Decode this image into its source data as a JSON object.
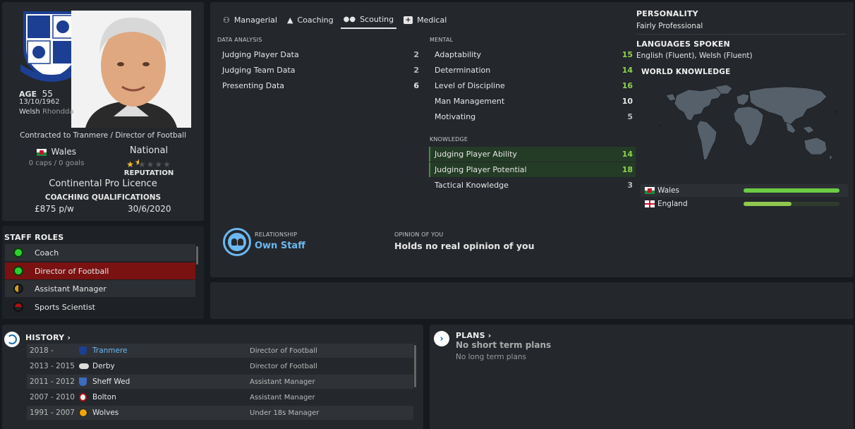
{
  "profile": {
    "age_label": "AGE",
    "age": "55",
    "dob": "13/10/1962",
    "nationality": "Welsh",
    "birthplace": "Rhondda",
    "contract": "Contracted to Tranmere / Director of Football",
    "nation": "Wales",
    "caps": "0 caps / 0 goals",
    "reputation_level": "National",
    "reputation_label": "REPUTATION",
    "reputation_stars": 1.5,
    "licence": "Continental Pro Licence",
    "qualifications_label": "COACHING QUALIFICATIONS",
    "wage": "£875 p/w",
    "contract_end": "30/6/2020"
  },
  "staff_roles": {
    "title": "STAFF ROLES",
    "items": [
      {
        "label": "Coach",
        "suitability": "green"
      },
      {
        "label": "Director of Football",
        "suitability": "green"
      },
      {
        "label": "Assistant Manager",
        "suitability": "half"
      },
      {
        "label": "Sports Scientist",
        "suitability": "red"
      }
    ]
  },
  "tabs": [
    {
      "label": "Managerial",
      "icon": "managerial-icon"
    },
    {
      "label": "Coaching",
      "icon": "coaching-icon"
    },
    {
      "label": "Scouting",
      "icon": "binoculars-icon"
    },
    {
      "label": "Medical",
      "icon": "medical-icon"
    }
  ],
  "data_analysis": {
    "title": "DATA ANALYSIS",
    "rows": [
      {
        "label": "Judging Player Data",
        "value": "2"
      },
      {
        "label": "Judging Team Data",
        "value": "2"
      },
      {
        "label": "Presenting Data",
        "value": "6"
      }
    ]
  },
  "mental": {
    "title": "MENTAL",
    "rows": [
      {
        "label": "Adaptability",
        "value": "15"
      },
      {
        "label": "Determination",
        "value": "14"
      },
      {
        "label": "Level of Discipline",
        "value": "16"
      },
      {
        "label": "Man Management",
        "value": "10"
      },
      {
        "label": "Motivating",
        "value": "5"
      }
    ]
  },
  "knowledge": {
    "title": "KNOWLEDGE",
    "rows": [
      {
        "label": "Judging Player Ability",
        "value": "14"
      },
      {
        "label": "Judging Player Potential",
        "value": "18"
      },
      {
        "label": "Tactical Knowledge",
        "value": "3"
      }
    ]
  },
  "relationship": {
    "label": "RELATIONSHIP",
    "value": "Own Staff",
    "opinion_label": "OPINION OF YOU",
    "opinion_value": "Holds no real opinion of you"
  },
  "personality": {
    "title": "PERSONALITY",
    "value": "Fairly Professional",
    "languages_title": "LANGUAGES SPOKEN",
    "languages": "English (Fluent), Welsh (Fluent)",
    "world_title": "WORLD KNOWLEDGE",
    "countries": [
      {
        "name": "Wales",
        "level": 1.0
      },
      {
        "name": "England",
        "level": 0.5
      }
    ]
  },
  "history": {
    "title": "HISTORY",
    "rows": [
      {
        "years": "2018 -",
        "club": "Tranmere",
        "role": "Director of Football",
        "highlight": true
      },
      {
        "years": "2013 - 2015",
        "club": "Derby",
        "role": "Director of Football",
        "highlight": false
      },
      {
        "years": "2011 - 2012",
        "club": "Sheff Wed",
        "role": "Assistant Manager",
        "highlight": false
      },
      {
        "years": "2007 - 2010",
        "club": "Bolton",
        "role": "Assistant Manager",
        "highlight": false
      },
      {
        "years": "1991 - 2007",
        "club": "Wolves",
        "role": "Under 18s Manager",
        "highlight": false
      }
    ]
  },
  "plans": {
    "title": "PLANS",
    "short_term": "No short term plans",
    "long_term": "No long term plans"
  },
  "colors": {
    "green_attr": "#8fd14f",
    "accent_blue": "#6cb8f0",
    "highlight_red": "#7a1212",
    "bar_green": "#6ccc44"
  }
}
